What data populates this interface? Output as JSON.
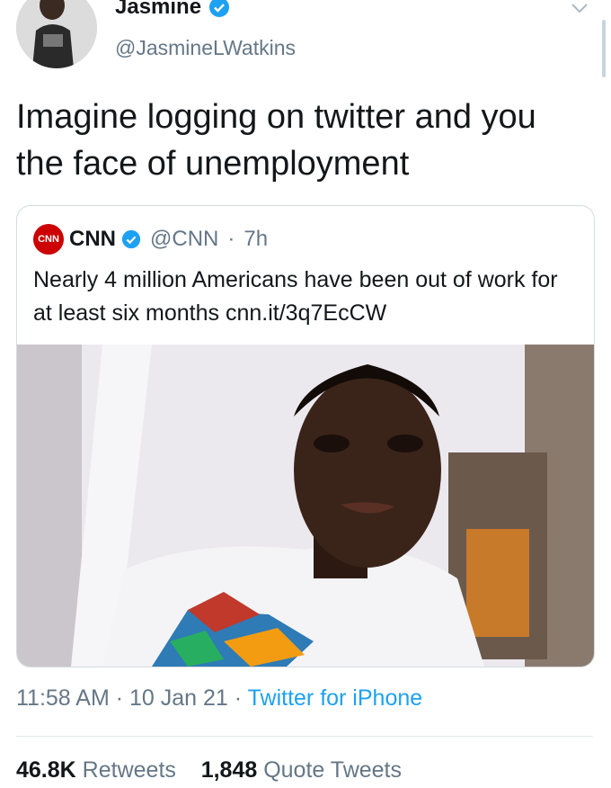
{
  "tweet": {
    "author_name": "Jasmine",
    "author_handle": "@JasmineLWatkins",
    "text": "Imagine logging on twitter and you the face of unemployment",
    "time": "11:58 AM",
    "date": "10 Jan 21",
    "source": "Twitter for iPhone",
    "separator": "·",
    "retweets_count": "46.8K",
    "retweets_label": "Retweets",
    "quote_count": "1,848",
    "quote_label": "Quote Tweets"
  },
  "quoted_tweet": {
    "logo_text": "CNN",
    "name": "CNN",
    "handle": "@CNN",
    "age": "7h",
    "text": "Nearly 4 million Americans have been out of work for at least six months cnn.it/3q7EcCW"
  },
  "colors": {
    "verified": "#1da1f2",
    "link": "#1da1f2",
    "muted": "#657786",
    "cnn_red": "#cc0000"
  },
  "icons": [
    "verified-badge-icon",
    "chevron-down-icon",
    "cnn-logo"
  ]
}
